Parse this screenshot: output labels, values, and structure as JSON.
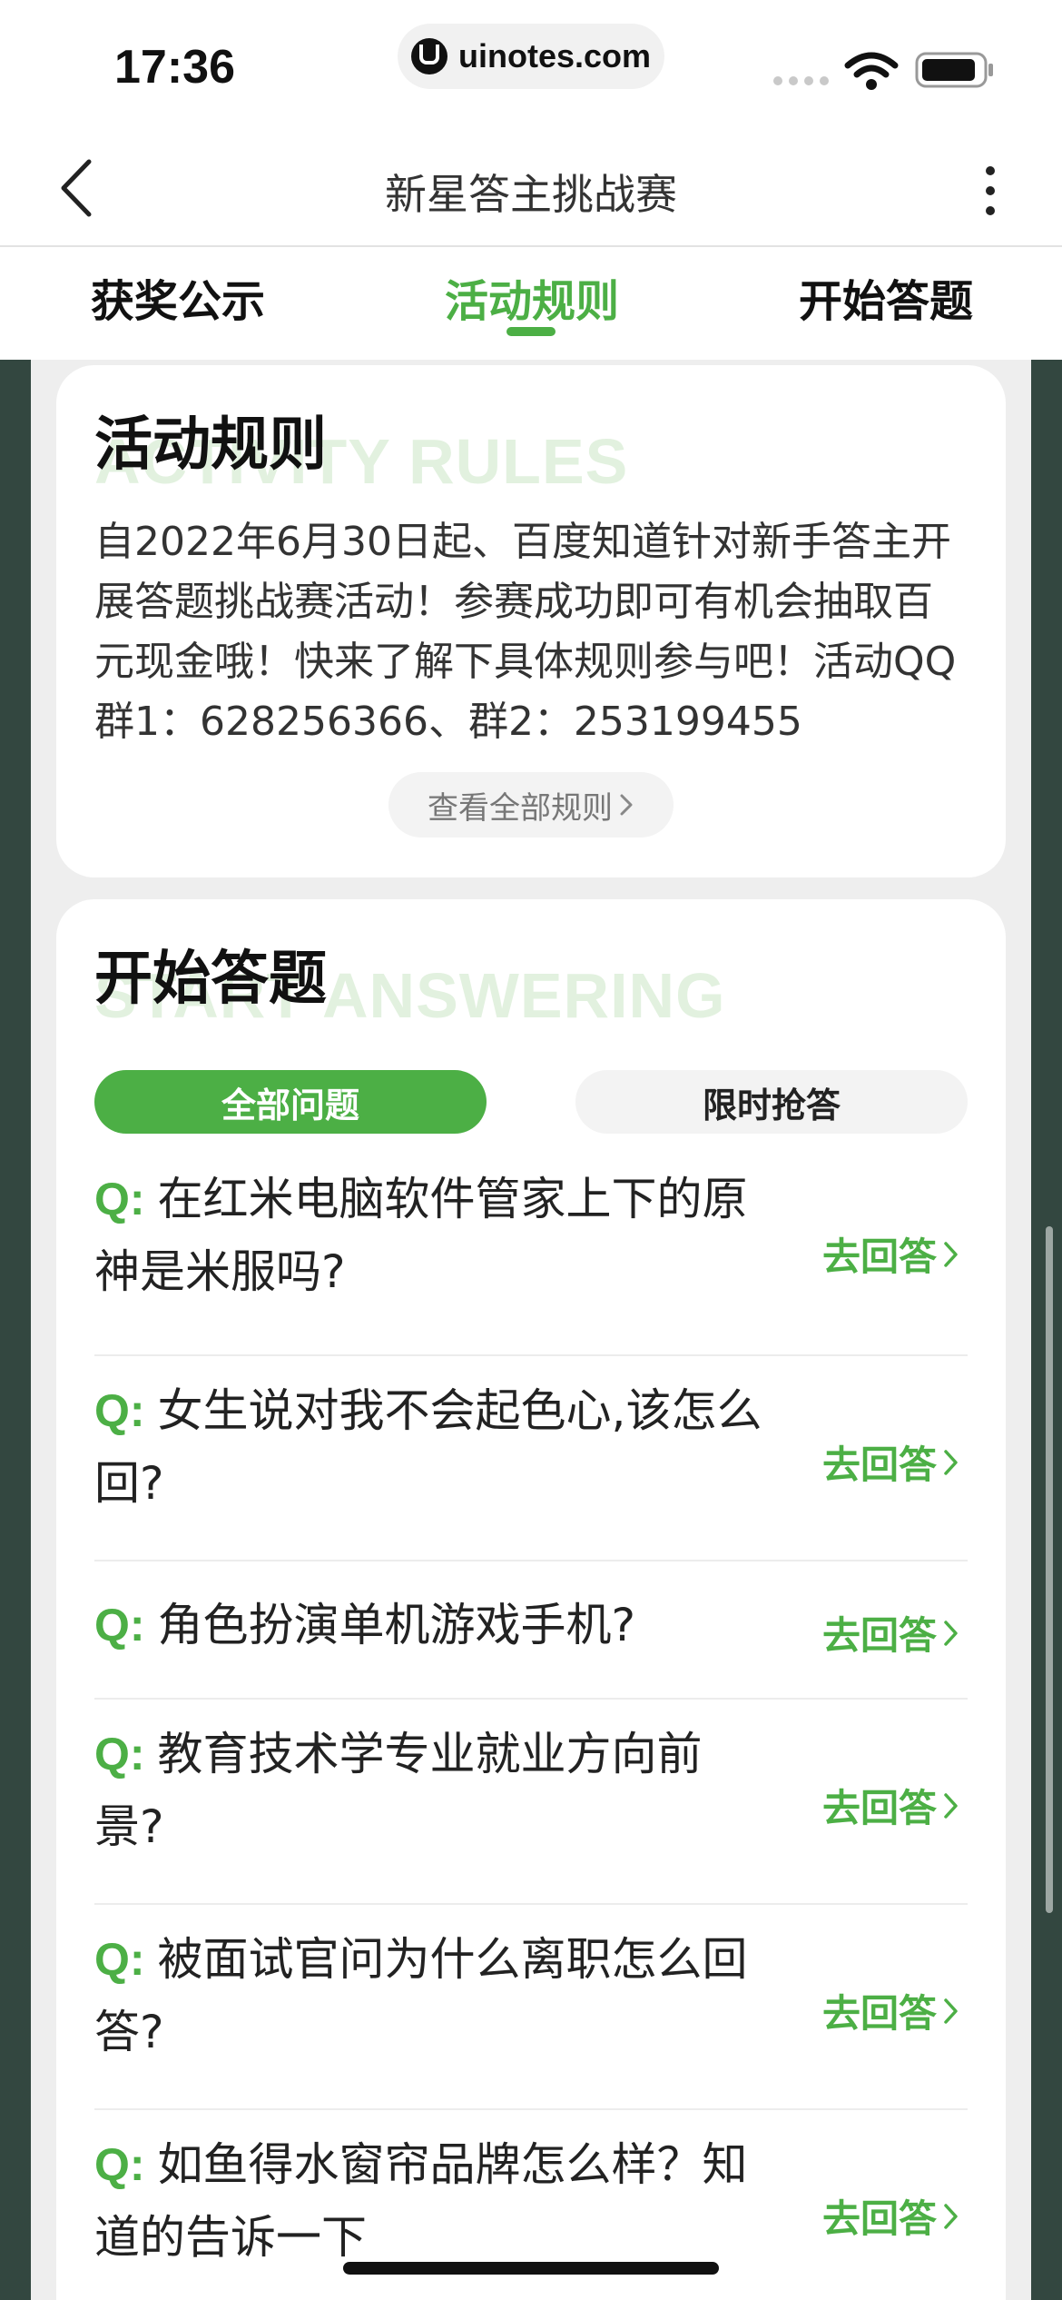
{
  "status_bar": {
    "time": "17:36",
    "url": "uinotes.com"
  },
  "nav": {
    "title": "新星答主挑战赛"
  },
  "tabs": [
    {
      "label": "获奖公示",
      "active": false
    },
    {
      "label": "活动规则",
      "active": true
    },
    {
      "label": "开始答题",
      "active": false
    }
  ],
  "rules_section": {
    "title": "活动规则",
    "subtitle_en": "ACTIVITY RULES",
    "description": "自2022年6月30日起、百度知道针对新手答主开展答题挑战赛活动！参赛成功即可有机会抽取百元现金哦！快来了解下具体规则参与吧！活动QQ群1：628256366、群2：253199455",
    "view_all_label": "查看全部规则"
  },
  "answer_section": {
    "title": "开始答题",
    "subtitle_en": "START ANSWERING",
    "filters": {
      "all": "全部问题",
      "timed": "限时抢答"
    },
    "q_prefix": "Q:",
    "answer_label": "去回答",
    "questions": [
      "在红米电脑软件管家上下的原神是米服吗?",
      "女生说对我不会起色心,该怎么回?",
      "角色扮演单机游戏手机?",
      "教育技术学专业就业方向前景?",
      "被面试官问为什么离职怎么回答?",
      "如鱼得水窗帘品牌怎么样？知道的告诉一下"
    ]
  },
  "colors": {
    "accent_green": "#4caf45",
    "side_dark": "#334740",
    "page_gray": "#eeeeee",
    "watermark_green": "#e2f1df"
  }
}
